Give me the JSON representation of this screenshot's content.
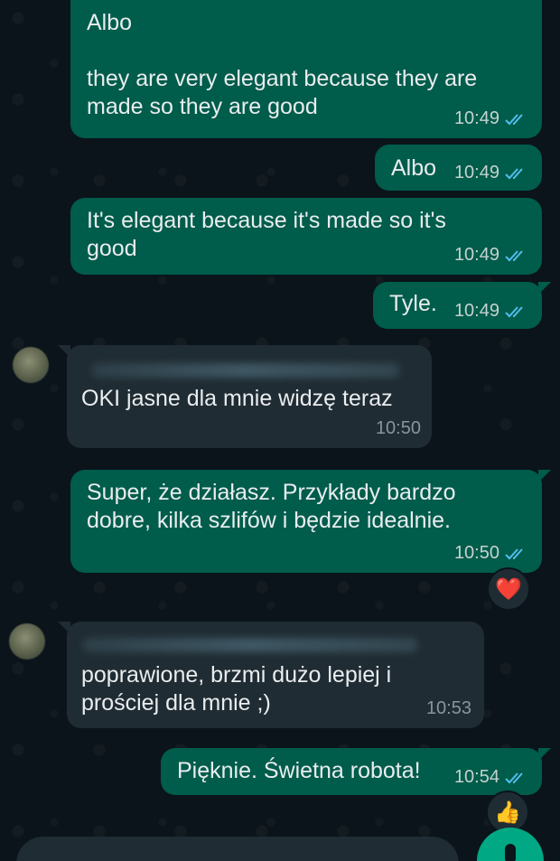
{
  "messages": [
    {
      "text": "Albo\n\nthey are very elegant because they are\nmade so they are good",
      "time": "10:49"
    },
    {
      "text": "Albo",
      "time": "10:49"
    },
    {
      "text": "It's elegant because it's made so it's\ngood",
      "time": "10:49"
    },
    {
      "text": "Tyle.",
      "time": "10:49"
    },
    {
      "text": "OKI jasne dla mnie widzę teraz",
      "time": "10:50"
    },
    {
      "text": "Super, że działasz. Przykłady bardzo\ndobre, kilka szlifów i będzie idealnie.",
      "time": "10:50",
      "reaction": "❤️"
    },
    {
      "text": "poprawione, brzmi dużo lepiej i\nprościej dla mnie ;)",
      "time": "10:53"
    },
    {
      "text": "Pięknie. Świetna robota!",
      "time": "10:54",
      "reaction": "👍"
    }
  ],
  "colors": {
    "outgoing": "#005c4b",
    "incoming": "#202c33",
    "ticks": "#53bdeb",
    "accent": "#00a884"
  },
  "icons": {
    "read_receipt": "double-check-icon",
    "fab": "mic-icon"
  }
}
